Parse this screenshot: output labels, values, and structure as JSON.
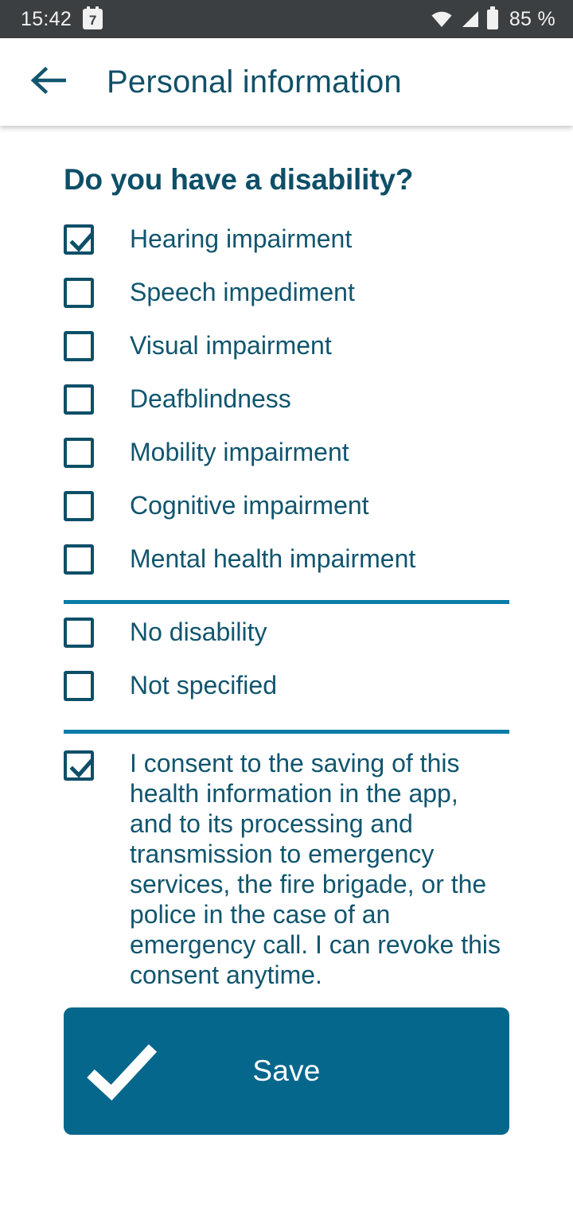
{
  "status_bar": {
    "time": "15:42",
    "calendar_day": "7",
    "battery_label": "85 %",
    "icons": [
      "calendar-icon",
      "wifi-icon",
      "signal-icon",
      "battery-icon"
    ],
    "background_color": "#3c3f41",
    "foreground_color": "#f1f1f1"
  },
  "app_bar": {
    "back_icon": "arrow-left-icon",
    "title": "Personal information",
    "title_color": "#115068"
  },
  "main": {
    "heading": "Do you have a disability?",
    "disability_options": [
      {
        "label": "Hearing impairment",
        "checked": true
      },
      {
        "label": "Speech impediment",
        "checked": false
      },
      {
        "label": "Visual impairment",
        "checked": false
      },
      {
        "label": "Deafblindness",
        "checked": false
      },
      {
        "label": "Mobility impairment",
        "checked": false
      },
      {
        "label": "Cognitive impairment",
        "checked": false
      },
      {
        "label": "Mental health impairment",
        "checked": false
      }
    ],
    "other_options": [
      {
        "label": "No disability",
        "checked": false
      },
      {
        "label": "Not specified",
        "checked": false
      }
    ],
    "consent": {
      "label": "I consent to the saving of this health information in the app, and to its processing and transmission to emergency services, the fire brigade, or the police in the case of an emergency call. I can revoke this consent anytime.",
      "checked": true
    },
    "save_button": {
      "label": "Save",
      "icon": "check-icon",
      "background_color": "#06678c",
      "text_color": "#ffffff"
    },
    "divider_color": "#0b7ca8",
    "text_color": "#11556e",
    "checkbox_border_color": "#0d4f68"
  }
}
